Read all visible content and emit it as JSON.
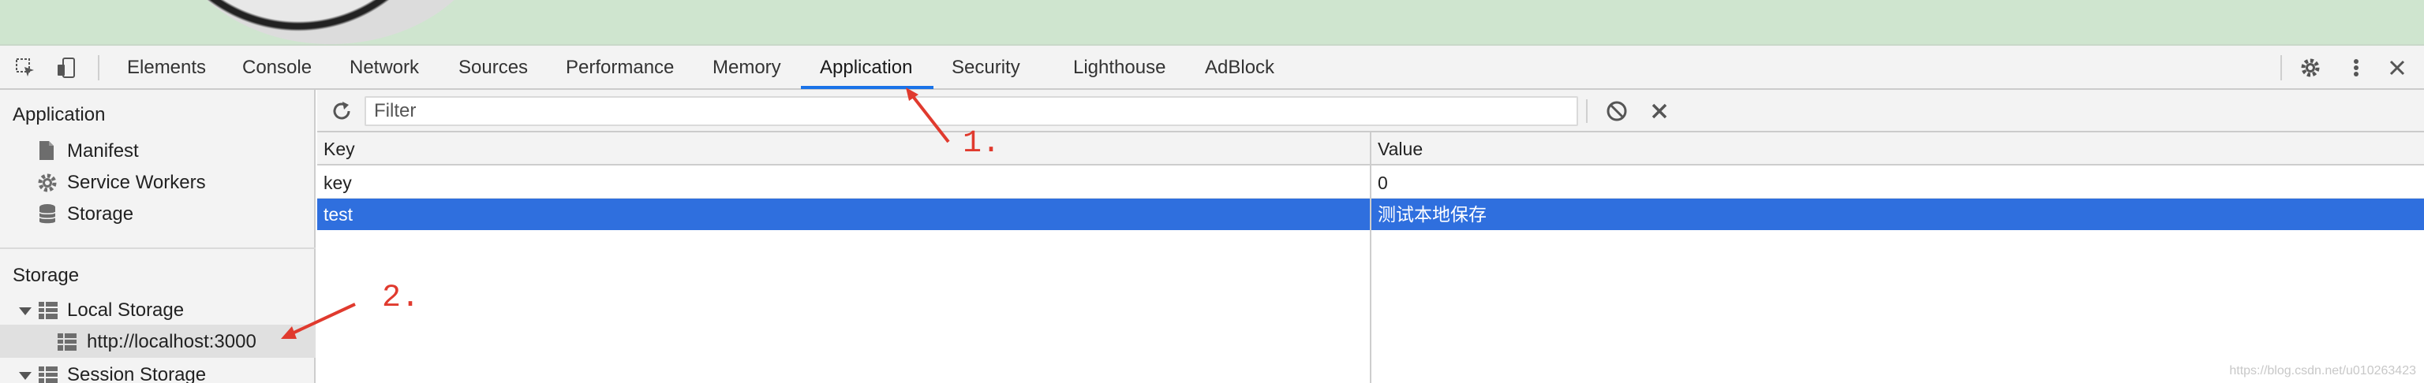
{
  "devtools": {
    "tabs": [
      "Elements",
      "Console",
      "Network",
      "Sources",
      "Performance",
      "Memory",
      "Application",
      "Security",
      "Lighthouse",
      "AdBlock"
    ],
    "active_tab": "Application",
    "accent_color": "#1a73e8"
  },
  "sidebar": {
    "application_heading": "Application",
    "application_items": [
      {
        "label": "Manifest",
        "icon": "file-icon"
      },
      {
        "label": "Service Workers",
        "icon": "gear-icon"
      },
      {
        "label": "Storage",
        "icon": "database-icon"
      }
    ],
    "storage_heading": "Storage",
    "local_storage_label": "Local Storage",
    "local_storage_origin": "http://localhost:3000",
    "session_storage_label": "Session Storage"
  },
  "filter": {
    "placeholder": "Filter"
  },
  "table": {
    "columns": [
      "Key",
      "Value"
    ],
    "rows": [
      {
        "key": "key",
        "value": "0",
        "selected": false
      },
      {
        "key": "test",
        "value": "测试本地保存",
        "selected": true
      }
    ],
    "selection_color": "#2f6fde"
  },
  "annotations": {
    "note_1": "1.",
    "note_2": "2.",
    "color": "#e03a2e"
  },
  "watermark": "https://blog.csdn.net/u010263423"
}
